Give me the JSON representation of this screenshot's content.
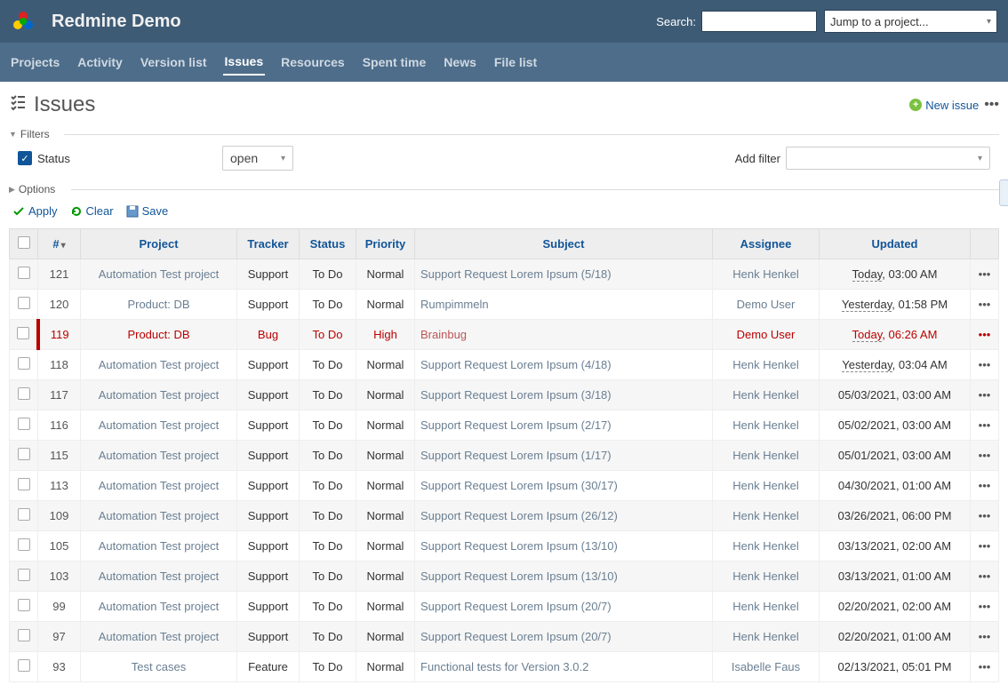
{
  "header": {
    "title": "Redmine Demo",
    "search_label": "Search:",
    "jump_placeholder": "Jump to a project..."
  },
  "nav": {
    "items": [
      {
        "label": "Projects",
        "active": false
      },
      {
        "label": "Activity",
        "active": false
      },
      {
        "label": "Version list",
        "active": false
      },
      {
        "label": "Issues",
        "active": true
      },
      {
        "label": "Resources",
        "active": false
      },
      {
        "label": "Spent time",
        "active": false
      },
      {
        "label": "News",
        "active": false
      },
      {
        "label": "File list",
        "active": false
      }
    ]
  },
  "page": {
    "title": "Issues",
    "new_issue_label": "New issue"
  },
  "filters": {
    "legend": "Filters",
    "status_label": "Status",
    "status_value": "open",
    "options_legend": "Options",
    "add_filter_label": "Add filter"
  },
  "actions": {
    "apply": "Apply",
    "clear": "Clear",
    "save": "Save"
  },
  "table": {
    "headers": {
      "id": "#",
      "project": "Project",
      "tracker": "Tracker",
      "status": "Status",
      "priority": "Priority",
      "subject": "Subject",
      "assignee": "Assignee",
      "updated": "Updated"
    },
    "rows": [
      {
        "id": "121",
        "project": "Automation Test project",
        "tracker": "Support",
        "status": "To Do",
        "priority": "Normal",
        "subject": "Support Request Lorem Ipsum (5/18)",
        "assignee": "Henk Henkel",
        "updated_prefix": "Today",
        "updated_rest": ", 03:00 AM",
        "bug": false
      },
      {
        "id": "120",
        "project": "Product: DB",
        "tracker": "Support",
        "status": "To Do",
        "priority": "Normal",
        "subject": "Rumpimmeln",
        "assignee": "Demo User",
        "updated_prefix": "Yesterday",
        "updated_rest": ", 01:58 PM",
        "bug": false
      },
      {
        "id": "119",
        "project": "Product: DB",
        "tracker": "Bug",
        "status": "To Do",
        "priority": "High",
        "subject": "Brainbug",
        "assignee": "Demo User",
        "updated_prefix": "Today",
        "updated_rest": ", 06:26 AM",
        "bug": true
      },
      {
        "id": "118",
        "project": "Automation Test project",
        "tracker": "Support",
        "status": "To Do",
        "priority": "Normal",
        "subject": "Support Request Lorem Ipsum (4/18)",
        "assignee": "Henk Henkel",
        "updated_prefix": "Yesterday",
        "updated_rest": ", 03:04 AM",
        "bug": false
      },
      {
        "id": "117",
        "project": "Automation Test project",
        "tracker": "Support",
        "status": "To Do",
        "priority": "Normal",
        "subject": "Support Request Lorem Ipsum (3/18)",
        "assignee": "Henk Henkel",
        "updated_prefix": "",
        "updated_rest": "05/03/2021, 03:00 AM",
        "bug": false
      },
      {
        "id": "116",
        "project": "Automation Test project",
        "tracker": "Support",
        "status": "To Do",
        "priority": "Normal",
        "subject": "Support Request Lorem Ipsum (2/17)",
        "assignee": "Henk Henkel",
        "updated_prefix": "",
        "updated_rest": "05/02/2021, 03:00 AM",
        "bug": false
      },
      {
        "id": "115",
        "project": "Automation Test project",
        "tracker": "Support",
        "status": "To Do",
        "priority": "Normal",
        "subject": "Support Request Lorem Ipsum (1/17)",
        "assignee": "Henk Henkel",
        "updated_prefix": "",
        "updated_rest": "05/01/2021, 03:00 AM",
        "bug": false
      },
      {
        "id": "113",
        "project": "Automation Test project",
        "tracker": "Support",
        "status": "To Do",
        "priority": "Normal",
        "subject": "Support Request Lorem Ipsum (30/17)",
        "assignee": "Henk Henkel",
        "updated_prefix": "",
        "updated_rest": "04/30/2021, 01:00 AM",
        "bug": false
      },
      {
        "id": "109",
        "project": "Automation Test project",
        "tracker": "Support",
        "status": "To Do",
        "priority": "Normal",
        "subject": "Support Request Lorem Ipsum (26/12)",
        "assignee": "Henk Henkel",
        "updated_prefix": "",
        "updated_rest": "03/26/2021, 06:00 PM",
        "bug": false
      },
      {
        "id": "105",
        "project": "Automation Test project",
        "tracker": "Support",
        "status": "To Do",
        "priority": "Normal",
        "subject": "Support Request Lorem Ipsum (13/10)",
        "assignee": "Henk Henkel",
        "updated_prefix": "",
        "updated_rest": "03/13/2021, 02:00 AM",
        "bug": false
      },
      {
        "id": "103",
        "project": "Automation Test project",
        "tracker": "Support",
        "status": "To Do",
        "priority": "Normal",
        "subject": "Support Request Lorem Ipsum (13/10)",
        "assignee": "Henk Henkel",
        "updated_prefix": "",
        "updated_rest": "03/13/2021, 01:00 AM",
        "bug": false
      },
      {
        "id": "99",
        "project": "Automation Test project",
        "tracker": "Support",
        "status": "To Do",
        "priority": "Normal",
        "subject": "Support Request Lorem Ipsum (20/7)",
        "assignee": "Henk Henkel",
        "updated_prefix": "",
        "updated_rest": "02/20/2021, 02:00 AM",
        "bug": false
      },
      {
        "id": "97",
        "project": "Automation Test project",
        "tracker": "Support",
        "status": "To Do",
        "priority": "Normal",
        "subject": "Support Request Lorem Ipsum (20/7)",
        "assignee": "Henk Henkel",
        "updated_prefix": "",
        "updated_rest": "02/20/2021, 01:00 AM",
        "bug": false
      },
      {
        "id": "93",
        "project": "Test cases",
        "tracker": "Feature",
        "status": "To Do",
        "priority": "Normal",
        "subject": "Functional tests for Version 3.0.2",
        "assignee": "Isabelle Faus",
        "updated_prefix": "",
        "updated_rest": "02/13/2021, 05:01 PM",
        "bug": false
      }
    ]
  }
}
